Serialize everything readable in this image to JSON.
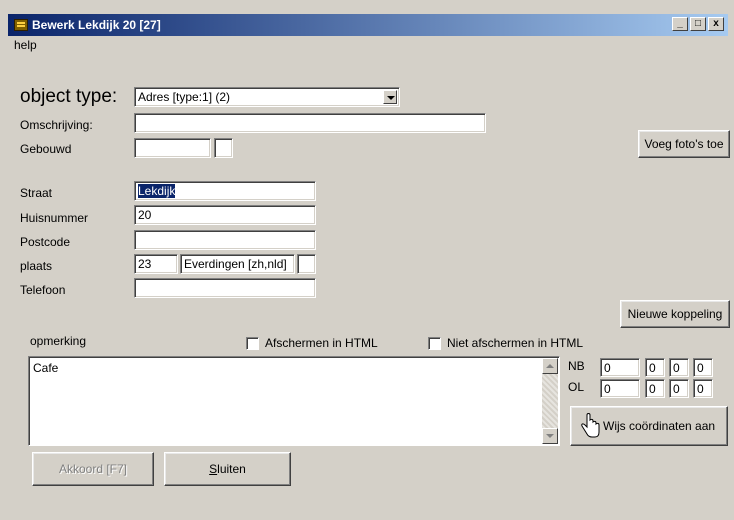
{
  "window": {
    "title": "Bewerk Lekdijk 20 [27]",
    "minimize": "_",
    "maximize": "□",
    "close": "x"
  },
  "menu": {
    "help": "help"
  },
  "object_type": {
    "label": "object type:",
    "value": "Adres [type:1] (2)"
  },
  "labels": {
    "omschrijving": "Omschrijving:",
    "gebouwd": "Gebouwd",
    "straat": "Straat",
    "huisnummer": "Huisnummer",
    "postcode": "Postcode",
    "plaats": "plaats",
    "telefoon": "Telefoon",
    "opmerking": "opmerking",
    "nb": "NB",
    "ol": "OL"
  },
  "fields": {
    "omschrijving": "",
    "gebouwd": "",
    "gebouwd_extra": "",
    "straat": "Lekdijk",
    "huisnummer": "20",
    "postcode": "",
    "plaats_code": "23",
    "plaats_name": "Everdingen [zh,nld]",
    "plaats_extra": "",
    "telefoon": "",
    "opmerking": "Cafe"
  },
  "checkboxes": {
    "afschermen": "Afschermen in HTML",
    "niet_afschermen": "Niet afschermen in HTML"
  },
  "coordinates": {
    "nb": [
      "0",
      "0",
      "0",
      "0"
    ],
    "ol": [
      "0",
      "0",
      "0",
      "0"
    ]
  },
  "buttons": {
    "voeg_foto": "Voeg foto's toe",
    "nieuwe_koppeling": "Nieuwe koppeling",
    "wijs_coordinaten": "Wijs coördinaten aan",
    "akkoord": "Akkoord [F7]",
    "sluiten_hot": "S",
    "sluiten_rest": "luiten"
  },
  "icons": {
    "app": "app-icon",
    "hand": "hand-pointer-icon"
  }
}
